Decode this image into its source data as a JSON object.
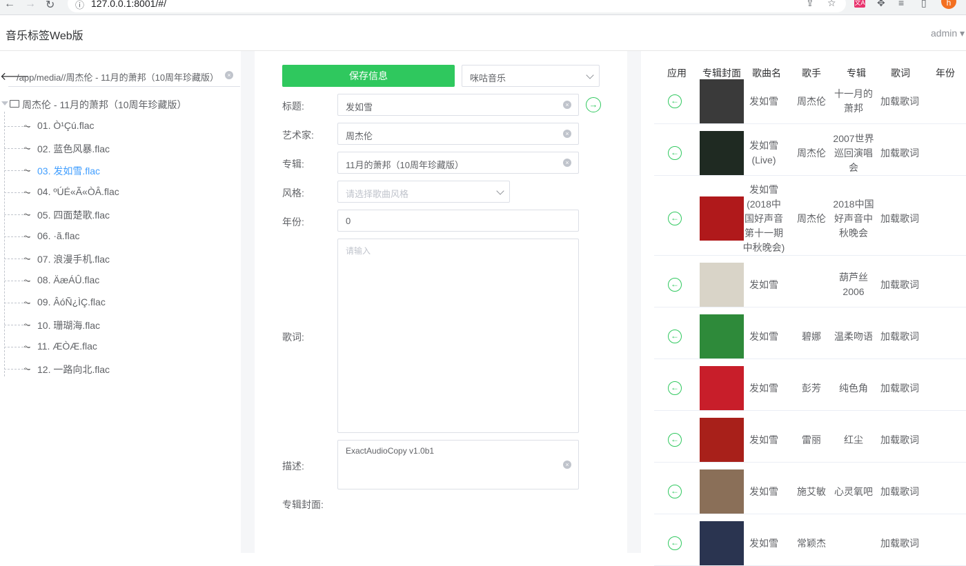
{
  "browser": {
    "url": "127.0.0.1:8001/#/",
    "avatar_letter": "h",
    "ext_label": "文A"
  },
  "app": {
    "title": "音乐标签Web版",
    "user": "admin ▾"
  },
  "sidebar": {
    "path": "/app/media//周杰伦 - 11月的萧邦（10周年珍藏版）",
    "root_folder": "周杰伦 - 11月的萧邦（10周年珍藏版）",
    "files": [
      {
        "label": "01. Ò¹Çú.flac"
      },
      {
        "label": "02. 蓝色风暴.flac"
      },
      {
        "label": "03. 发如雪.flac"
      },
      {
        "label": "04. ºÚÉ«Ã«ÒÂ.flac"
      },
      {
        "label": "05. 四面楚歌.flac"
      },
      {
        "label": "06. ·ã.flac"
      },
      {
        "label": "07. 浪漫手机.flac"
      },
      {
        "label": "08. ÄæÁÛ.flac"
      },
      {
        "label": "09. ÂóÑ¿ÌÇ.flac"
      },
      {
        "label": "10. 珊瑚海.flac"
      },
      {
        "label": "11. ÆÒÆ.flac"
      },
      {
        "label": "12. 一路向北.flac"
      }
    ]
  },
  "form": {
    "save_label": "保存信息",
    "source_value": "咪咕音乐",
    "title_label": "标题:",
    "title_value": "发如雪",
    "artist_label": "艺术家:",
    "artist_value": "周杰伦",
    "album_label": "专辑:",
    "album_value": "11月的萧邦（10周年珍藏版）",
    "genre_label": "风格:",
    "genre_placeholder": "请选择歌曲风格",
    "year_label": "年份:",
    "year_value": "0",
    "lyrics_label": "歌词:",
    "lyrics_placeholder": "请输入",
    "desc_label": "描述:",
    "desc_value": "ExactAudioCopy v1.0b1",
    "cover_label": "专辑封面:"
  },
  "results": {
    "headers": [
      "应用",
      "专辑封面",
      "歌曲名",
      "歌手",
      "专辑",
      "歌词",
      "年份"
    ],
    "rows": [
      {
        "song": "发如雪",
        "artist": "周杰伦",
        "album": "十一月的萧邦",
        "lyrics": "加载歌词"
      },
      {
        "song": "发如雪(Live)",
        "artist": "周杰伦",
        "album": "2007世界巡回演唱会",
        "lyrics": "加载歌词"
      },
      {
        "song": "发如雪(2018中国好声音第十一期中秋晚会)",
        "artist": "周杰伦",
        "album": "2018中国好声音中秋晚会",
        "lyrics": "加载歌词"
      },
      {
        "song": "发如雪",
        "artist": "",
        "album": "葫芦丝2006",
        "lyrics": "加载歌词"
      },
      {
        "song": "发如雪",
        "artist": "碧娜",
        "album": "温柔吻语",
        "lyrics": "加载歌词"
      },
      {
        "song": "发如雪",
        "artist": "彭芳",
        "album": "纯色角",
        "lyrics": "加载歌词"
      },
      {
        "song": "发如雪",
        "artist": "雷丽",
        "album": "红尘",
        "lyrics": "加载歌词"
      },
      {
        "song": "发如雪",
        "artist": "施艾敏",
        "album": "心灵氧吧",
        "lyrics": "加载歌词"
      },
      {
        "song": "发如雪",
        "artist": "常颖杰",
        "album": "",
        "lyrics": "加载歌词"
      }
    ],
    "cover_colors": [
      "#3a3a3a",
      "#1f2a22",
      "#b0191b",
      "#d9d4c8",
      "#2e8a3a",
      "#c81e2a",
      "#a8201a",
      "#8a6f58",
      "#2a3450"
    ],
    "accent": "#2fc85e"
  }
}
